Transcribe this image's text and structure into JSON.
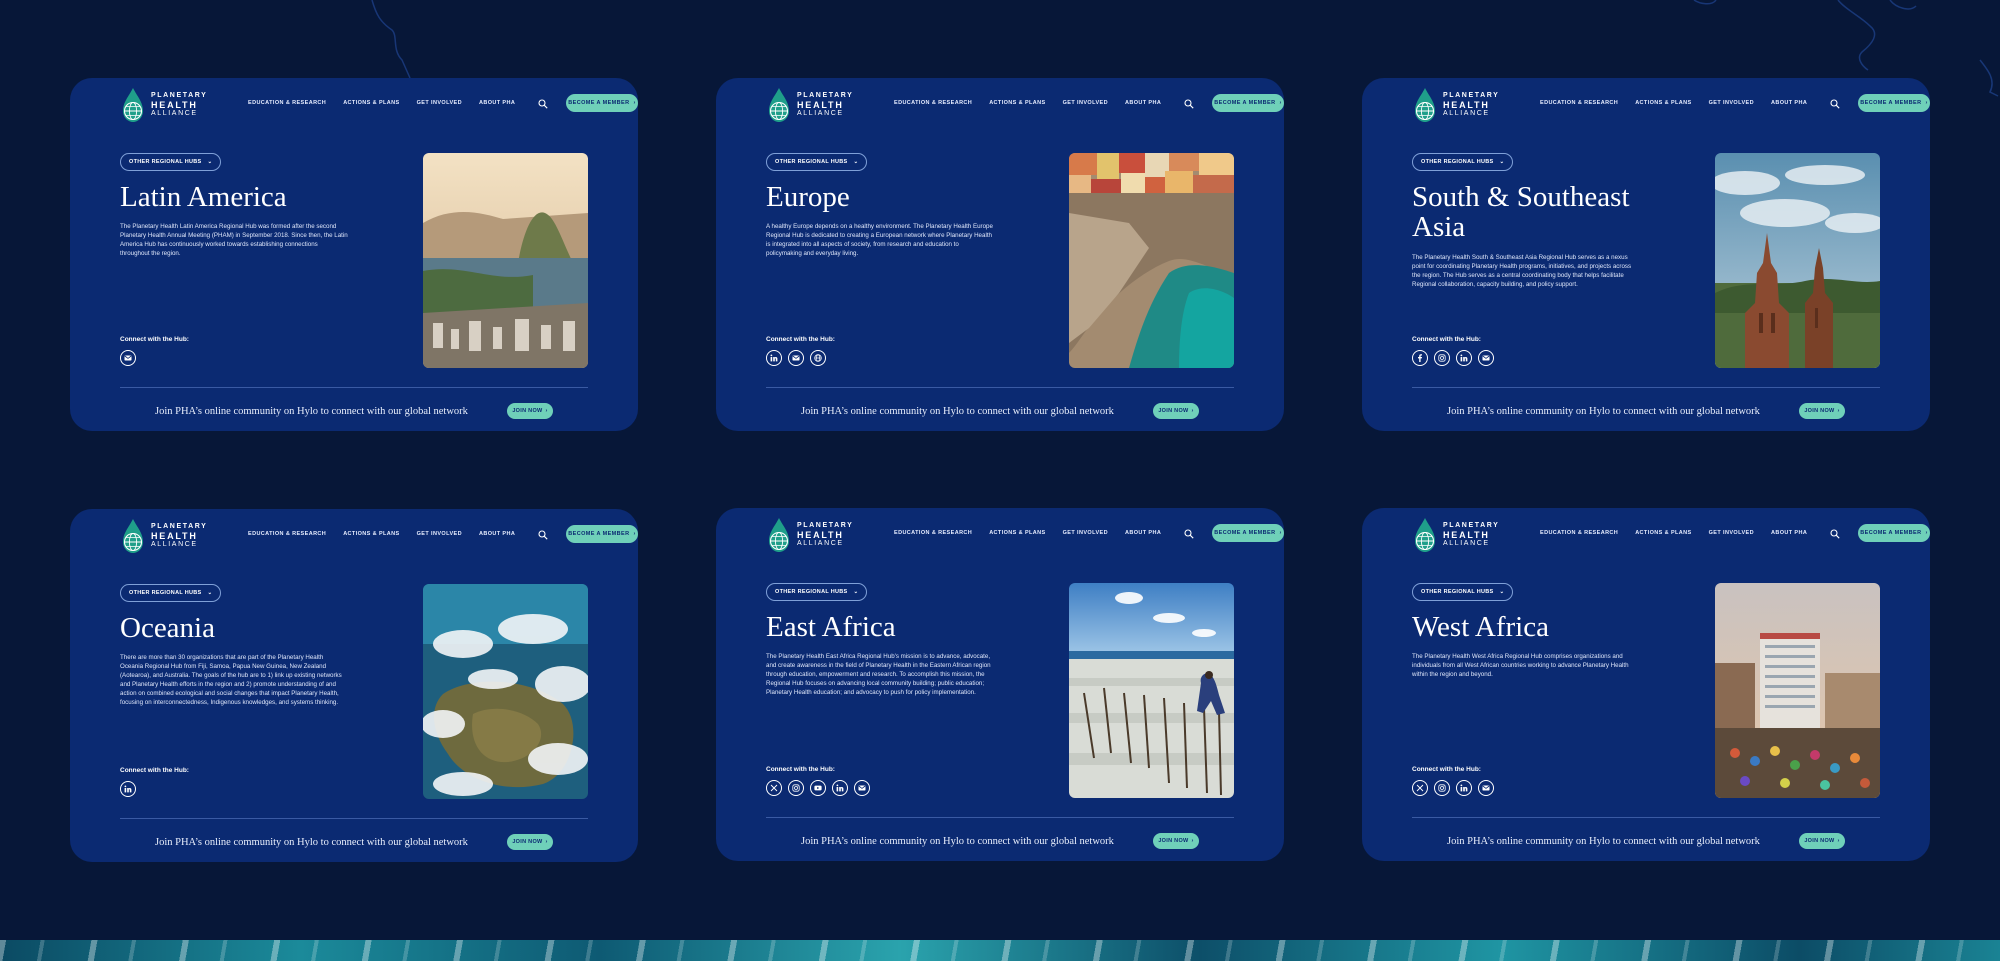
{
  "colors": {
    "page_bg": "#071738",
    "card_bg": "#0b2a72",
    "accent": "#6fd0b9"
  },
  "nav": {
    "logo_line1": "PLANETARY",
    "logo_line2": "HEALTH",
    "logo_line3": "ALLIANCE",
    "links": [
      "EDUCATION & RESEARCH",
      "ACTIONS & PLANS",
      "GET INVOLVED",
      "ABOUT PHA"
    ],
    "member_button": "BECOME A MEMBER",
    "search_icon": "search-icon"
  },
  "common": {
    "hub_dropdown": "OTHER REGIONAL HUBS",
    "connect_label": "Connect with the Hub:",
    "footer_text": "Join PHA’s online community on Hylo to connect with our global network",
    "join_button": "JOIN NOW"
  },
  "hubs": [
    {
      "title": "Latin America",
      "description": "The Planetary Health Latin America Regional Hub was formed after the second Planetary Health Annual Meeting (PHAM) in September 2018. Since then, the Latin America Hub has continuously worked towards establishing connections throughout the region.",
      "socials": [
        "email-icon"
      ]
    },
    {
      "title": "Europe",
      "description": "A healthy Europe depends on a healthy environment. The Planetary Health Europe Regional Hub is dedicated to creating a European network where Planetary Health is integrated into all aspects of society, from research and education to policymaking and everyday living.",
      "socials": [
        "linkedin-icon",
        "email-icon",
        "globe-icon"
      ]
    },
    {
      "title": "South & Southeast Asia",
      "description": "The Planetary Health South & Southeast Asia Regional Hub serves as a nexus point for coordinating Planetary Health programs, initiatives, and projects across the region. The Hub serves as a central coordinating body that helps facilitate Regional collaboration, capacity building, and policy support.",
      "socials": [
        "facebook-icon",
        "instagram-icon",
        "linkedin-icon",
        "email-icon"
      ]
    },
    {
      "title": "Oceania",
      "description": "There are more than 30 organizations that are part of the Planetary Health Oceania Regional Hub from Fiji, Samoa, Papua New Guinea, New Zealand (Aotearoa), and Australia. The goals of the hub are to 1) link up existing networks and Planetary Health efforts in the region and 2) promote understanding of and action on combined ecological and social changes that impact Planetary Health, focusing on interconnectedness, Indigenous knowledges, and systems thinking.",
      "socials": [
        "linkedin-icon"
      ]
    },
    {
      "title": "East Africa",
      "description": "The Planetary Health East Africa Regional Hub's mission is to advance, advocate, and create awareness in the field of Planetary Health in the Eastern African region through education, empowerment and research. To accomplish this mission, the Regional Hub focuses on advancing local community building; public education; Planetary Health education; and advocacy to push for policy implementation.",
      "socials": [
        "x-icon",
        "instagram-icon",
        "youtube-icon",
        "linkedin-icon",
        "email-icon"
      ]
    },
    {
      "title": "West Africa",
      "description": "The Planetary Health West Africa Regional Hub comprises organizations and individuals from all West African countries working to advance Planetary Health within the region and beyond.",
      "socials": [
        "x-icon",
        "instagram-icon",
        "linkedin-icon",
        "email-icon"
      ]
    }
  ]
}
